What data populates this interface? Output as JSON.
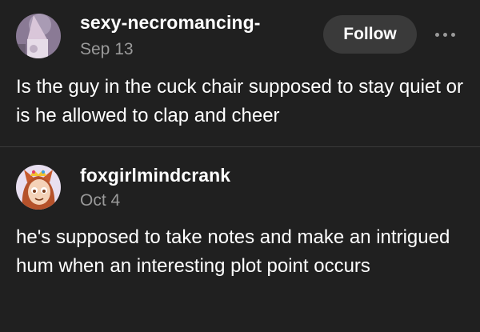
{
  "posts": [
    {
      "username": "sexy-necromancing-",
      "date": "Sep 13",
      "follow_label": "Follow",
      "text": "Is the guy in the cuck chair supposed to stay quiet or is he allowed to clap and cheer"
    },
    {
      "username": "foxgirlmindcrank",
      "date": "Oct 4",
      "text": "he's supposed to take notes and make an intrigued hum when an interesting plot point occurs"
    }
  ],
  "colors": {
    "background": "#202020",
    "text_primary": "#ffffff",
    "text_secondary": "#9a9a9a",
    "button_bg": "#3a3a3a",
    "divider": "#3a3a3a"
  },
  "icons": {
    "more": "more-horizontal-icon"
  }
}
